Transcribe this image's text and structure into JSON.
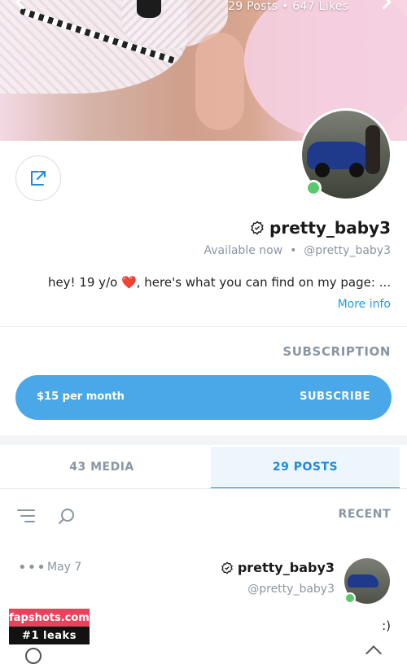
{
  "header": {
    "stats": "29 Posts  •  647 Likes"
  },
  "profile": {
    "name": "pretty_baby3",
    "handle": "@pretty_baby3",
    "status": "Available now",
    "bio_text": "hey! 19 y/o ",
    "bio_heart": "❤️",
    "bio_rest": ", here's what you can find on my page: ...",
    "more_info": "More info"
  },
  "subscription": {
    "label": "SUBSCRIPTION",
    "button_label": "SUBSCRIBE",
    "price": "$15 per month"
  },
  "tabs": {
    "posts": "29 POSTS",
    "media": "43 MEDIA"
  },
  "filter": {
    "label": "RECENT"
  },
  "post": {
    "author": "pretty_baby3",
    "handle": "@pretty_baby3",
    "date": "May 7",
    "more": "•••",
    "text": ":)"
  },
  "watermark": {
    "line1": "fapshots.com",
    "line2": "#1 leaks"
  },
  "colors": {
    "accent": "#1a8be0",
    "button": "#4aa8e8",
    "online": "#5ac96c",
    "muted": "#8a96a3"
  },
  "icons": [
    "share-icon",
    "verified-icon",
    "search-icon",
    "sort-icon",
    "chevron-left-icon",
    "chevron-right-icon"
  ]
}
